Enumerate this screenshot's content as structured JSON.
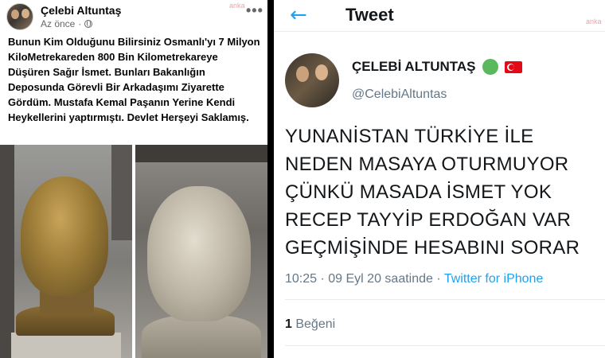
{
  "facebook_post": {
    "author": "Çelebi Altuntaş",
    "time": "Az önce",
    "more_icon": "more-horizontal-icon",
    "privacy_icon": "globe-icon",
    "text": "Bunun Kim Olduğunu Bilirsiniz Osmanlı'yı 7 Milyon KiloMetrekareden 800 Bin Kilometrekareye Düşüren Sağır İsmet. Bunları Bakanlığın Deposunda Görevli Bir Arkadaşımı Ziyarette Gördüm. Mustafa Kemal Paşanın Yerine Kendi Heykellerini yaptırmıştı. Devlet Herşeyi Saklamış.",
    "watermark": "anka"
  },
  "tweet": {
    "header_title": "Tweet",
    "back_icon": "arrow-left-icon",
    "author_name": "ÇELEBİ ALTUNTAŞ",
    "handle": "@CelebiAltuntas",
    "text": "YUNANİSTAN TÜRKİYE İLE NEDEN MASAYA OTURMUYOR ÇÜNKÜ MASADA İSMET YOK RECEP TAYYİP ERDOĞAN VAR GEÇMİŞİNDE HESABINI SORAR",
    "timestamp": "10:25 · 09 Eyl 20 saatinde ·",
    "source": "Twitter for iPhone",
    "likes_count": "1",
    "likes_label": "Beğeni",
    "watermark": "anka",
    "colors": {
      "accent": "#1da1f2",
      "flag_red": "#e30a17",
      "dot_green": "#5cb85c"
    }
  }
}
